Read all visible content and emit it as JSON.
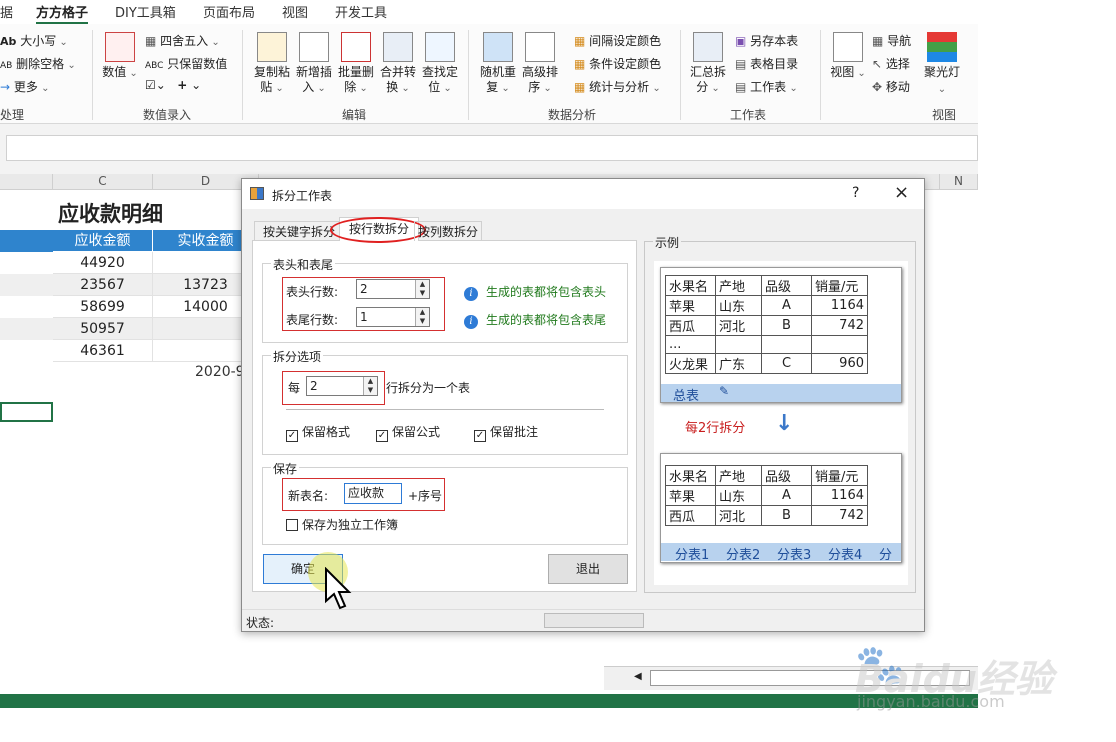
{
  "ribbon": {
    "tabs": [
      "据",
      "方方格子",
      "DIY工具箱",
      "页面布局",
      "视图",
      "开发工具"
    ],
    "groups": {
      "text": {
        "items": [
          "大小写",
          "删除空格",
          "更多"
        ],
        "label": "处理"
      },
      "input": {
        "big": "数值",
        "items": [
          "四舍五入",
          "只保留数值"
        ],
        "label": "数值录入"
      },
      "edit": {
        "buttons": [
          "复制粘贴",
          "新增插入",
          "批量删除",
          "合并转换",
          "查找定位"
        ],
        "label": "编辑"
      },
      "analysis": {
        "buttons": [
          "随机重复",
          "高级排序"
        ],
        "items": [
          "间隔设定颜色",
          "条件设定颜色",
          "统计与分析"
        ],
        "label": "数据分析"
      },
      "sheet": {
        "big": "汇总拆分",
        "items": [
          "另存本表",
          "表格目录",
          "工作表"
        ],
        "label": "工作表"
      },
      "view": {
        "big": "视图",
        "items": [
          "导航",
          "选择",
          "移动"
        ],
        "big2": "聚光灯",
        "label": "视图"
      }
    }
  },
  "sheet": {
    "col_headers": [
      "C",
      "D",
      "N"
    ],
    "title": "应收款明细",
    "headers": [
      "应收金额",
      "实收金额"
    ],
    "rows": [
      [
        "44920",
        ""
      ],
      [
        "23567",
        "13723"
      ],
      [
        "58699",
        "14000"
      ],
      [
        "50957",
        ""
      ],
      [
        "46361",
        ""
      ]
    ],
    "date_fragment": "2020-9"
  },
  "dialog": {
    "title": "拆分工作表",
    "help": "?",
    "close": "×",
    "tabs": [
      "按关键字拆分",
      "按行数拆分",
      "按列数拆分"
    ],
    "header_footer": {
      "legend": "表头和表尾",
      "header_label": "表头行数:",
      "header_value": "2",
      "footer_label": "表尾行数:",
      "footer_value": "1",
      "header_info": "生成的表都将包含表头",
      "footer_info": "生成的表都将包含表尾"
    },
    "split": {
      "legend": "拆分选项",
      "prefix": "每",
      "value": "2",
      "suffix": "行拆分为一个表",
      "keep_format": "保留格式",
      "keep_formula": "保留公式",
      "keep_comment": "保留批注"
    },
    "save": {
      "legend": "保存",
      "name_label": "新表名:",
      "name_value": "应收款",
      "name_suffix": "+序号",
      "independent": "保存为独立工作簿"
    },
    "ok": "确定",
    "exit": "退出",
    "status": "状态:",
    "example": {
      "legend": "示例",
      "headers": [
        "水果名",
        "产地",
        "品级",
        "销量/元"
      ],
      "rows": [
        [
          "苹果",
          "山东",
          "A",
          "1164"
        ],
        [
          "西瓜",
          "河北",
          "B",
          "742"
        ],
        [
          "...",
          "",
          "",
          ""
        ],
        [
          "火龙果",
          "广东",
          "C",
          "960"
        ]
      ],
      "source_tab": "总表",
      "caption": "每2行拆分",
      "result_rows": [
        [
          "苹果",
          "山东",
          "A",
          "1164"
        ],
        [
          "西瓜",
          "河北",
          "B",
          "742"
        ]
      ],
      "result_tabs": [
        "分表1",
        "分表2",
        "分表3",
        "分表4",
        "分表"
      ]
    }
  },
  "watermark": {
    "brand": "Baidu经验",
    "url": "jingyan.baidu.com"
  }
}
